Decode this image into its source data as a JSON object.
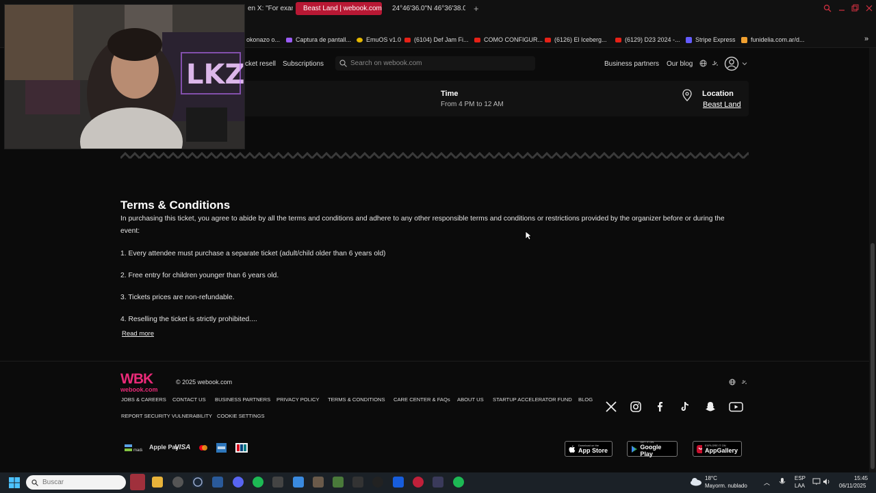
{
  "browser": {
    "tabs": [
      {
        "label": "en X: \"For exam",
        "active": false
      },
      {
        "label": "Beast Land | webook.com",
        "active": true
      },
      {
        "label": "24°46'36.0\"N 46°36'38.0",
        "active": false
      }
    ],
    "new_tab": "+",
    "bookmarks": [
      {
        "label": "okonazo o...",
        "color": "#ffffff"
      },
      {
        "label": "Captura de pantall...",
        "color": "#9b5cf6"
      },
      {
        "label": "EmuOS v1.0",
        "color": "#e6b800"
      },
      {
        "label": "(6104) Def Jam Fi...",
        "color": "#e62117"
      },
      {
        "label": "COMO CONFIGUR...",
        "color": "#e62117"
      },
      {
        "label": "(6126) El Iceberg...",
        "color": "#e62117"
      },
      {
        "label": "(6129) D23 2024 -...",
        "color": "#e62117"
      },
      {
        "label": "Stripe Express",
        "color": "#635bff"
      },
      {
        "label": "funidelia.com.ar/d...",
        "color": "#f0a030"
      }
    ],
    "more_bookmarks": "»"
  },
  "nav": {
    "ticket_resell": "cket resell",
    "subscriptions": "Subscriptions",
    "search_placeholder": "Search on webook.com",
    "business_partners": "Business partners",
    "our_blog": "Our blog"
  },
  "event": {
    "time_label": "Time",
    "time_value": "From 4 PM to 12 AM",
    "location_label": "Location",
    "location_value": "Beast Land"
  },
  "terms": {
    "title": "Terms & Conditions",
    "intro": "In purchasing this ticket, you agree to abide by all the terms and conditions and adhere to any other responsible terms and conditions or restrictions provided by the organizer before or during the event:",
    "items": [
      "1. Every attendee must purchase a separate ticket (adult/child older than 6 years old)",
      "2. Free entry for children younger than 6 years old.",
      "3. Tickets prices are non-refundable.",
      "4. Reselling the ticket is strictly prohibited...."
    ],
    "read_more": "Read more"
  },
  "footer": {
    "logo_top": "WBK",
    "logo_bottom": "webook.com",
    "copyright": "© 2025 webook.com",
    "links_row1": [
      "JOBS & CAREERS",
      "CONTACT US",
      "BUSINESS PARTNERS",
      "PRIVACY POLICY",
      "TERMS & CONDITIONS",
      "CARE CENTER & FAQs",
      "ABOUT US",
      "STARTUP ACCELERATOR FUND",
      "BLOG"
    ],
    "links_row2": [
      "REPORT SECURITY VULNERABILITY",
      "COOKIE SETTINGS"
    ],
    "payments": [
      "mada",
      "Apple Pay",
      "VISA"
    ],
    "stores": [
      {
        "small": "Download on the",
        "big": "App Store"
      },
      {
        "small": "GET IT ON",
        "big": "Google Play"
      },
      {
        "small": "EXPLORE IT ON",
        "big": "AppGallery"
      }
    ]
  },
  "taskbar": {
    "search_placeholder": "Buscar",
    "weather_temp": "18°C",
    "weather_desc": "Mayorm. nublado",
    "lang_top": "ESP",
    "lang_bottom": "LAA",
    "time": "15:45",
    "date": "06/11/2025"
  }
}
